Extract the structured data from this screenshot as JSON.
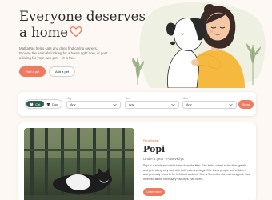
{
  "hero": {
    "title": "Everyone deserves a home",
    "description": "MatkaPas helps cats and dogs find caring owners. Browse the animals looking for a home right now, or post a listing for your own pet — it is free.",
    "find_button": "Find a pet",
    "add_button": "Add a pet"
  },
  "filters": {
    "pet_types": [
      {
        "label": "Cat",
        "icon": "cat-icon",
        "active": true
      },
      {
        "label": "Dog",
        "icon": "dog-icon",
        "active": false
      }
    ],
    "fields": [
      {
        "label": "City",
        "value": "Any"
      },
      {
        "label": "Sex",
        "value": "Any"
      },
      {
        "label": "Size",
        "value": "Any"
      }
    ],
    "show_button": "Show"
  },
  "featured": {
    "tag": "Pet of the day",
    "name": "Popi",
    "meta": "Under 1 year · Panevėžys",
    "description": "Popi is a black-and-white kitten from the litter. She is the cutest in the litter, gentle and gets along very well with both cats and dogs. She loves people and children and generally loves to be held and cuddled. She is 5 months old, microchipped, has received all the necessary vaccines, has been...",
    "learn_button": "Learn more"
  },
  "colors": {
    "accent": "#ef7a5f",
    "toggle_active": "#2f5d4e",
    "background": "#fdf8f3"
  }
}
